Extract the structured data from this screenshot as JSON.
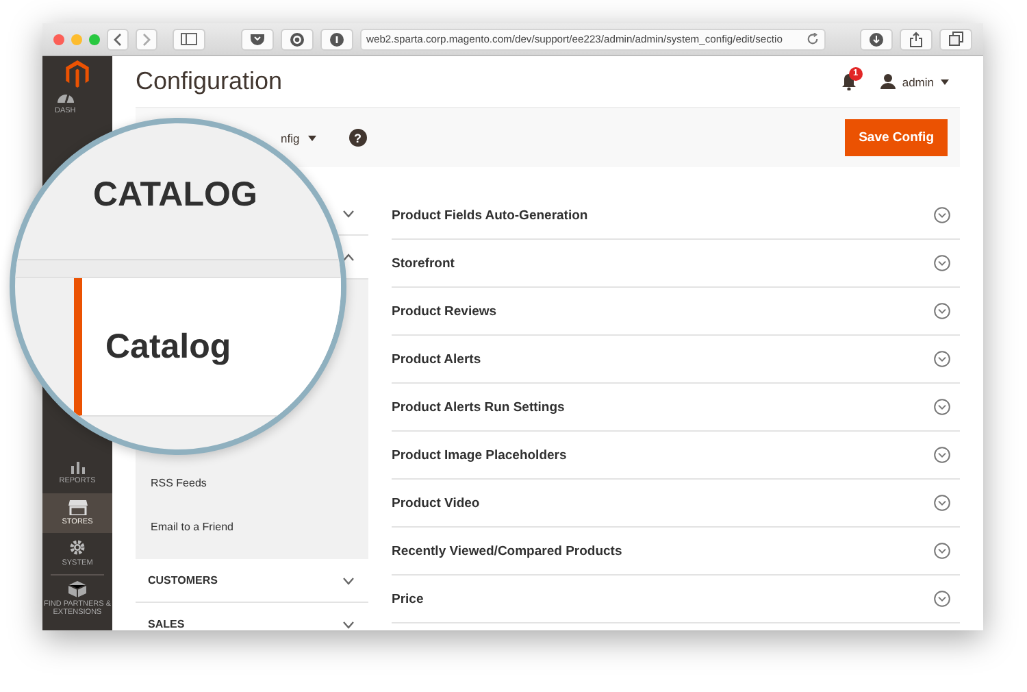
{
  "browser": {
    "url": "web2.sparta.corp.magento.com/dev/support/ee223/admin/admin/system_config/edit/sectio"
  },
  "sidebar": {
    "items": [
      {
        "kind": "dashboard",
        "label": "DASH",
        "selected": false
      },
      {
        "kind": "reports",
        "label": "REPORTS",
        "selected": false
      },
      {
        "kind": "stores",
        "label": "STORES",
        "selected": true
      },
      {
        "kind": "system",
        "label": "SYSTEM",
        "selected": false
      },
      {
        "kind": "partners",
        "label": "FIND PARTNERS & EXTENSIONS",
        "selected": false
      }
    ]
  },
  "header": {
    "title": "Configuration",
    "notifications": "1",
    "user": "admin"
  },
  "toolbar": {
    "scope": "nfig",
    "help": "?",
    "save_button": "Save Config"
  },
  "config_tabs": {
    "sections": [
      {
        "expanded": false
      },
      {
        "expanded": true,
        "items": [
          "RSS Feeds",
          "Email to a Friend"
        ]
      },
      {
        "label": "CUSTOMERS",
        "expanded": false
      },
      {
        "label": "SALES",
        "expanded": false
      }
    ]
  },
  "groups": [
    {
      "label": "Product Fields Auto-Generation",
      "expanded": false
    },
    {
      "label": "Storefront",
      "expanded": false
    },
    {
      "label": "Product Reviews",
      "expanded": false
    },
    {
      "label": "Product Alerts",
      "expanded": false
    },
    {
      "label": "Product Alerts Run Settings",
      "expanded": false
    },
    {
      "label": "Product Image Placeholders",
      "expanded": false
    },
    {
      "label": "Product Video",
      "expanded": false
    },
    {
      "label": "Recently Viewed/Compared Products",
      "expanded": false
    },
    {
      "label": "Price",
      "expanded": false
    }
  ],
  "magnifier": {
    "heading": "CATALOG",
    "item": "Catalog"
  }
}
